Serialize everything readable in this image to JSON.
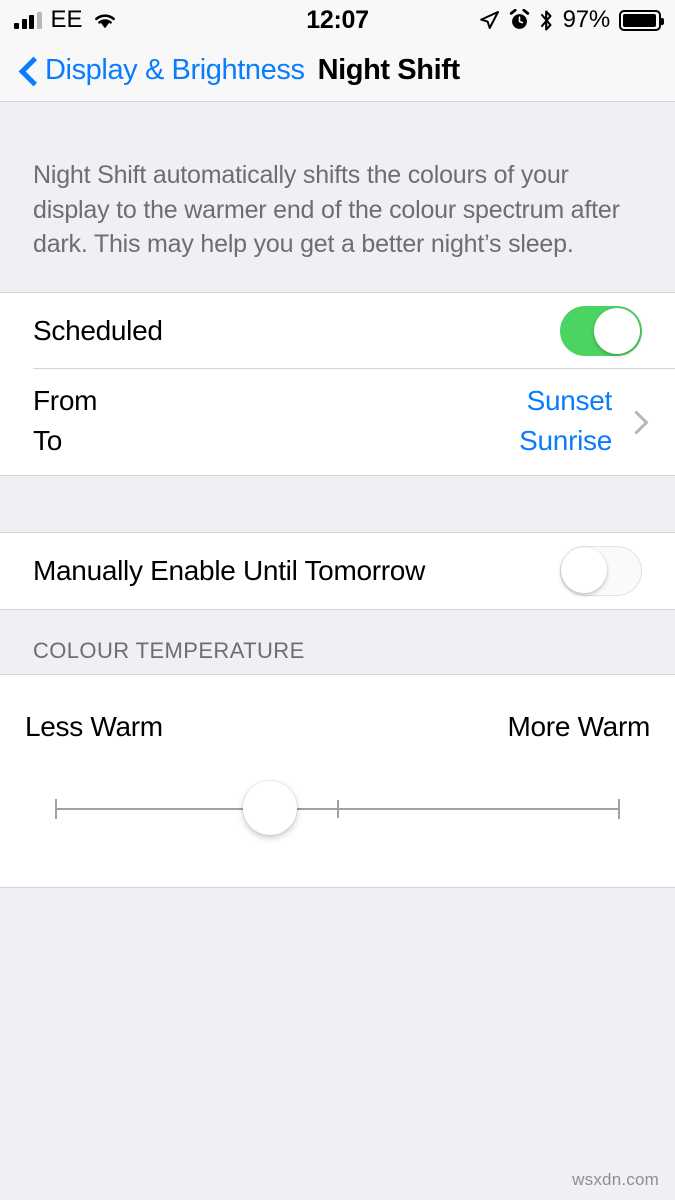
{
  "status_bar": {
    "carrier": "EE",
    "signal_bars_filled": 3,
    "signal_bars_total": 4,
    "wifi_icon": "wifi-icon",
    "time": "12:07",
    "location_icon": "location-arrow-icon",
    "alarm_icon": "alarm-clock-icon",
    "bluetooth_icon": "bluetooth-icon",
    "battery_percent": "97%",
    "battery_level": 97
  },
  "nav": {
    "back_label": "Display & Brightness",
    "back_icon": "chevron-left-icon",
    "title": "Night Shift"
  },
  "description": "Night Shift automatically shifts the colours of your display to the warmer end of the colour spectrum after dark. This may help you get a better night’s sleep.",
  "schedule_section": {
    "scheduled": {
      "label": "Scheduled",
      "toggle_state": "on"
    },
    "time_range": {
      "from_label": "From",
      "to_label": "To",
      "from_value": "Sunset",
      "to_value": "Sunrise",
      "disclosure_icon": "chevron-right-icon"
    }
  },
  "manual_section": {
    "label": "Manually Enable Until Tomorrow",
    "toggle_state": "off"
  },
  "colour_temperature": {
    "header": "COLOUR TEMPERATURE",
    "min_label": "Less Warm",
    "max_label": "More Warm",
    "value_percent": 38,
    "tick_percent": 50
  },
  "colors": {
    "accent_blue": "#0A7CFF",
    "toggle_green": "#4CD462",
    "background_gray": "#EFEFF4",
    "card_white": "#FFFFFF",
    "secondary_text": "#6D6D72",
    "separator": "#D3D3D8"
  },
  "watermark": "wsxdn.com"
}
